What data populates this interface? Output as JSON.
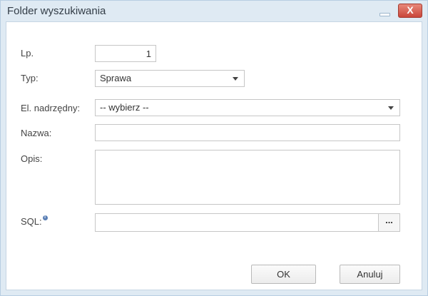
{
  "window": {
    "title": "Folder wyszukiwania",
    "close_label": "X"
  },
  "form": {
    "lp": {
      "label": "Lp.",
      "value": "1"
    },
    "typ": {
      "label": "Typ:",
      "value": "Sprawa"
    },
    "parent": {
      "label": "El. nadrzędny:",
      "value": "-- wybierz --"
    },
    "nazwa": {
      "label": "Nazwa:",
      "value": ""
    },
    "opis": {
      "label": "Opis:",
      "value": ""
    },
    "sql": {
      "label": "SQL:",
      "value": "",
      "browse_label": "..."
    }
  },
  "buttons": {
    "ok": "OK",
    "cancel": "Anuluj"
  },
  "colors": {
    "window_bg": "#dfeaf3",
    "close_btn": "#c9463a",
    "info_icon": "#5a7fb5"
  },
  "icons": {
    "minimize": "minimize-icon",
    "close": "close-icon",
    "info": "info-icon",
    "dropdown": "chevron-down-icon"
  }
}
